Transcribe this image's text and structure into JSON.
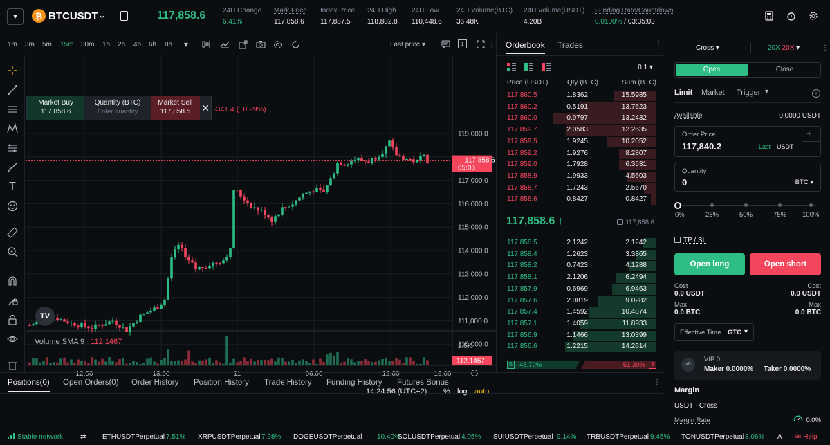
{
  "header": {
    "symbol": "BTCUSDT",
    "coin_glyph": "₿",
    "last_price": "117,858.6",
    "stats": [
      {
        "label": "24H Change",
        "value": "6.41%",
        "tone": "green",
        "underline": false
      },
      {
        "label": "Mark Price",
        "value": "117,858.6",
        "tone": "white",
        "underline": true
      },
      {
        "label": "Index Price",
        "value": "117,887.5",
        "tone": "white",
        "underline": false
      },
      {
        "label": "24H High",
        "value": "118,882.8",
        "tone": "white",
        "underline": false
      },
      {
        "label": "24H Low",
        "value": "110,448.6",
        "tone": "white",
        "underline": false
      },
      {
        "label": "24H Volume(BTC)",
        "value": "36.48K",
        "tone": "white",
        "underline": false
      },
      {
        "label": "24H Volume(USDT)",
        "value": "4.20B",
        "tone": "white",
        "underline": false
      }
    ],
    "funding_label": "Funding Rate/Countdown",
    "funding_rate": "0.0100%",
    "funding_countdown": " / 03:35:03"
  },
  "chart": {
    "timeframes": [
      "1m",
      "3m",
      "5m",
      "15m",
      "30m",
      "1h",
      "2h",
      "4h",
      "6h",
      "8h"
    ],
    "active_timeframe": "15m",
    "price_source": "Last price",
    "order_widget": {
      "buy_label": "Market Buy",
      "buy_price": "117,858.6",
      "qty_label": "Quantity (BTC)",
      "qty_placeholder": "Enter quantity",
      "sell_label": "Market Sell",
      "sell_price": "117,858.5",
      "change": "-341.4 (−0.29%)"
    },
    "price_ticks": [
      "119,000.0",
      "117,000.0",
      "116,000.0",
      "115,000.0",
      "114,000.0",
      "113,000.0",
      "112,000.0",
      "111,000.0",
      "110,000.0"
    ],
    "price_tag": "117,858.6",
    "price_tag_countdown": "05:03",
    "time_ticks": [
      "12:00",
      "18:00",
      "11",
      "06:00",
      "12:00",
      "16:00"
    ],
    "volume_label": "Volume SMA 9",
    "volume_value": "112.1467",
    "volume_tick": "2.5K",
    "volume_tag": "112.1467",
    "clock": "14:24:56 (UTC+2)",
    "scale_pct": "%",
    "scale_log": "log",
    "scale_auto": "auto",
    "logo_text": "TV"
  },
  "orderbook": {
    "tab_orderbook": "Orderbook",
    "tab_trades": "Trades",
    "precision": "0.1",
    "col_price": "Price (USDT)",
    "col_qty": "Qty (BTC)",
    "col_sum": "Sum (BTC)",
    "asks": [
      {
        "price": "117,860.5",
        "qty": "1.8362",
        "sum": "15.5985",
        "depth": 0.37
      },
      {
        "price": "117,860.2",
        "qty": "0.5191",
        "sum": "13.7623",
        "depth": 0.68
      },
      {
        "price": "117,860.0",
        "qty": "0.9797",
        "sum": "13.2432",
        "depth": 0.91
      },
      {
        "price": "117,859.7",
        "qty": "2.0583",
        "sum": "12.2635",
        "depth": 0.79
      },
      {
        "price": "117,859.5",
        "qty": "1.9245",
        "sum": "10.2052",
        "depth": 0.43
      },
      {
        "price": "117,859.2",
        "qty": "1.9276",
        "sum": "8.2807",
        "depth": 0.33
      },
      {
        "price": "117,859.0",
        "qty": "1.7928",
        "sum": "6.3531",
        "depth": 0.33
      },
      {
        "price": "117,858.9",
        "qty": "1.9933",
        "sum": "4.5603",
        "depth": 0.26
      },
      {
        "price": "117,858.7",
        "qty": "1.7243",
        "sum": "2.5670",
        "depth": 0.11
      },
      {
        "price": "117,858.6",
        "qty": "0.8427",
        "sum": "0.8427",
        "depth": 0.05
      }
    ],
    "mid_price": "117,858.6",
    "mid_arrow": "↑",
    "mark_price": "117,858.6",
    "bids": [
      {
        "price": "117,858.5",
        "qty": "2.1242",
        "sum": "2.1242",
        "depth": 0.12
      },
      {
        "price": "117,858.4",
        "qty": "1.2623",
        "sum": "3.3865",
        "depth": 0.18
      },
      {
        "price": "117,858.2",
        "qty": "0.7423",
        "sum": "4.1288",
        "depth": 0.24
      },
      {
        "price": "117,858.1",
        "qty": "2.1206",
        "sum": "6.2494",
        "depth": 0.35
      },
      {
        "price": "117,857.9",
        "qty": "0.6969",
        "sum": "6.9463",
        "depth": 0.39
      },
      {
        "price": "117,857.6",
        "qty": "2.0819",
        "sum": "9.0282",
        "depth": 0.51
      },
      {
        "price": "117,857.4",
        "qty": "1.4592",
        "sum": "10.4874",
        "depth": 0.59
      },
      {
        "price": "117,857.1",
        "qty": "1.4059",
        "sum": "11.8933",
        "depth": 0.67
      },
      {
        "price": "117,856.9",
        "qty": "1.1466",
        "sum": "13.0399",
        "depth": 0.73
      },
      {
        "price": "117,856.6",
        "qty": "1.2215",
        "sum": "14.2614",
        "depth": 0.8
      }
    ],
    "buy_letter": "B",
    "buy_pct": "48.70%",
    "sell_letter": "S",
    "sell_pct": "51.30%",
    "buy_ratio": 0.487
  },
  "trade": {
    "margin_mode": "Cross",
    "lev_long": "20X",
    "lev_short": "20X",
    "tab_open": "Open",
    "tab_close": "Close",
    "order_types": [
      "Limit",
      "Market",
      "Trigger"
    ],
    "available_label": "Available",
    "available_value": "0.0000 USDT",
    "order_price_label": "Order Price",
    "order_price_value": "117,840.2",
    "order_price_last": "Last",
    "order_price_unit": "USDT",
    "qty_label": "Quantity",
    "qty_value": "0",
    "qty_unit": "BTC",
    "slider_marks": [
      "0%",
      "25%",
      "50%",
      "75%",
      "100%"
    ],
    "tpsl": "TP / SL",
    "open_long": "Open long",
    "open_short": "Open short",
    "cost_label": "Cost",
    "cost_long": "0.0 USDT",
    "cost_short": "0.0 USDT",
    "max_label": "Max",
    "max_long": "0.0 BTC",
    "max_short": "0.0 BTC",
    "effective_time_label": "Effective Time",
    "effective_time_value": "GTC",
    "vip_label": "VIP 0",
    "vip_badge": "v0",
    "maker_fee": "Maker 0.0000%",
    "taker_fee": "Taker 0.0000%",
    "margin_title": "Margin",
    "margin_mode_line": "USDT · Cross",
    "margin_rate_label": "Margin Rate",
    "margin_rate_value": "0.0%"
  },
  "positions": {
    "tabs": [
      "Positions(0)",
      "Open Orders(0)",
      "Order History",
      "Position History",
      "Trade History",
      "Funding History",
      "Futures Bonus"
    ]
  },
  "footer": {
    "network": "Stable network",
    "tickers": [
      {
        "name": "ETHUSDTPerpetual",
        "change": "7.51%"
      },
      {
        "name": "XRPUSDTPerpetual",
        "change": "7.98%"
      },
      {
        "name": "DOGEUSDTPerpetual",
        "change": "10.40%"
      },
      {
        "name": "SOLUSDTPerpetual",
        "change": "4.05%"
      },
      {
        "name": "SUIUSDTPerpetual",
        "change": "9.14%"
      },
      {
        "name": "TRBUSDTPerpetual",
        "change": "9.45%"
      },
      {
        "name": "TONUSDTPerpetual",
        "change": "3.06%"
      }
    ],
    "ticker_tail": "A",
    "help": "Help"
  }
}
